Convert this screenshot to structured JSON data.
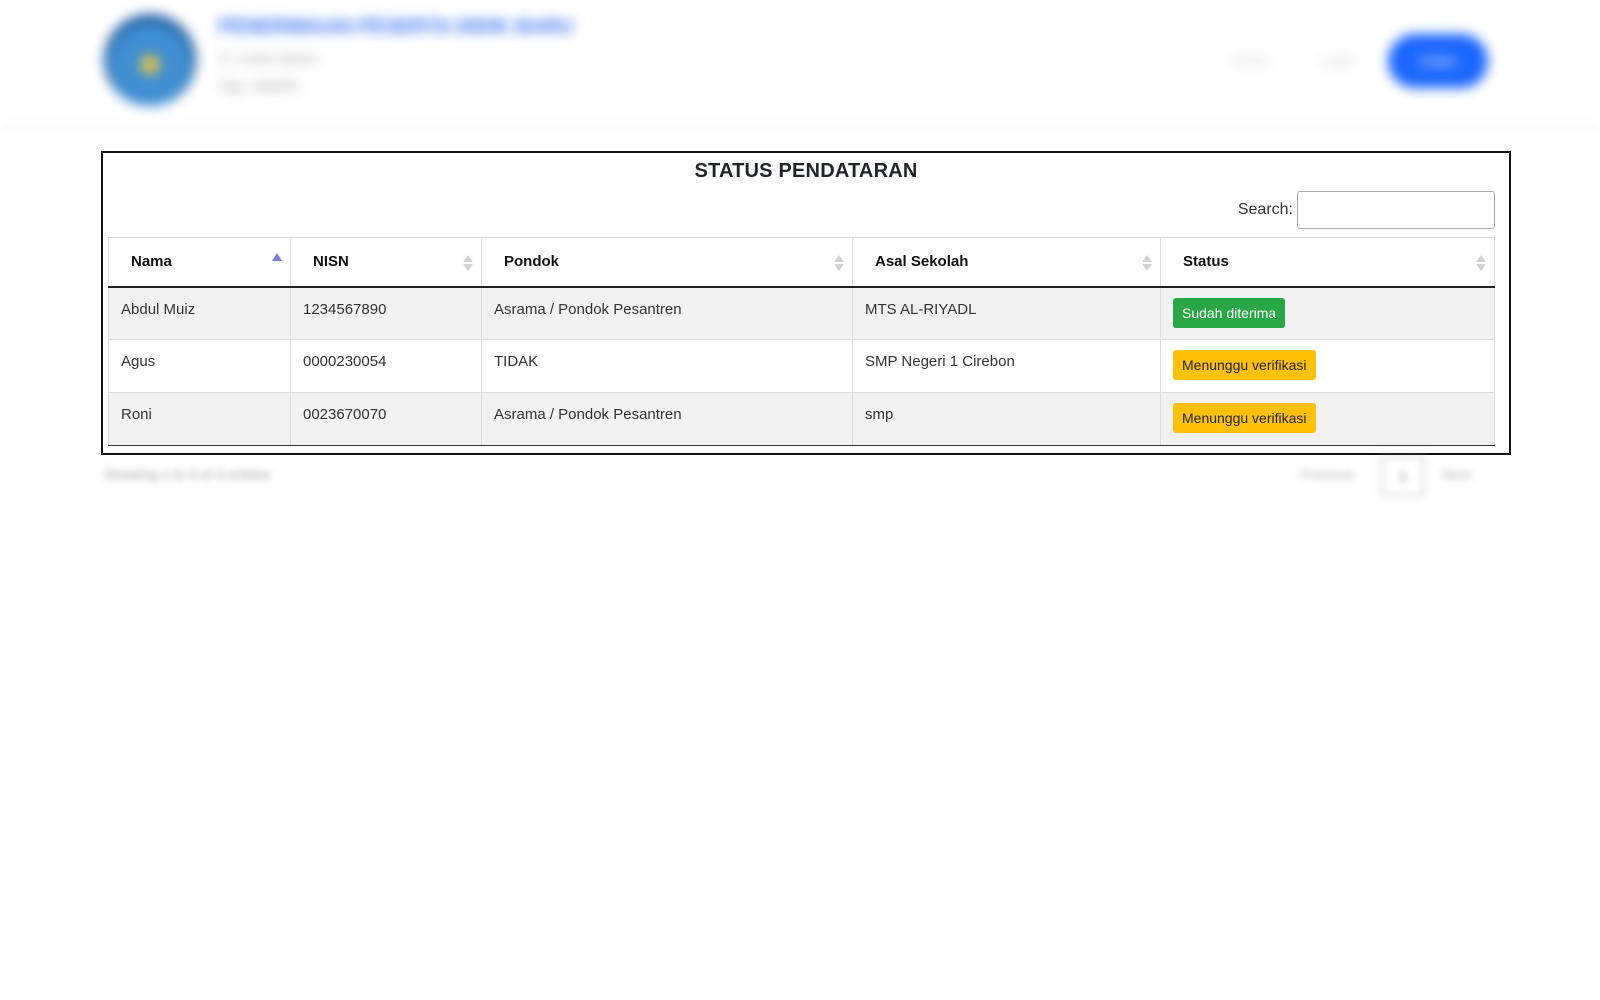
{
  "header": {
    "title": "PENERIMAAN PESERTA DIDIK BARU",
    "subtitle": "Jl. Lorem Ipsum",
    "subtitle2": "Telp. 000000",
    "nav": [
      "Home",
      "Login"
    ],
    "button_label": "Daftar"
  },
  "card": {
    "title": "STATUS PENDATARAN",
    "search_label": "Search:",
    "search_value": "",
    "columns": [
      "Nama",
      "NISN",
      "Pondok",
      "Asal Sekolah",
      "Status"
    ],
    "sorted_column": "Nama",
    "sort_direction": "ascending",
    "rows": [
      {
        "nama": "Abdul Muiz",
        "nisn": "1234567890",
        "pondok": "Asrama / Pondok Pesantren",
        "asal_sekolah": "MTS AL-RIYADL",
        "status": "Sudah diterima",
        "status_type": "success"
      },
      {
        "nama": "Agus",
        "nisn": "0000230054",
        "pondok": "TIDAK",
        "asal_sekolah": "SMP Negeri 1 Cirebon",
        "status": "Menunggu verifikasi",
        "status_type": "warning"
      },
      {
        "nama": "Roni",
        "nisn": "0023670070",
        "pondok": "Asrama / Pondok Pesantren",
        "asal_sekolah": "smp",
        "status": "Menunggu verifikasi",
        "status_type": "warning"
      }
    ]
  },
  "footer": {
    "info": "Showing 1 to 3 of 3 entries",
    "prev": "Previous",
    "current_page": "1",
    "next": "Next"
  },
  "colors": {
    "success": "#28a745",
    "warning": "#ffc107",
    "sort_active": "#7a7ed8",
    "brand_blue": "#1a66ff"
  }
}
